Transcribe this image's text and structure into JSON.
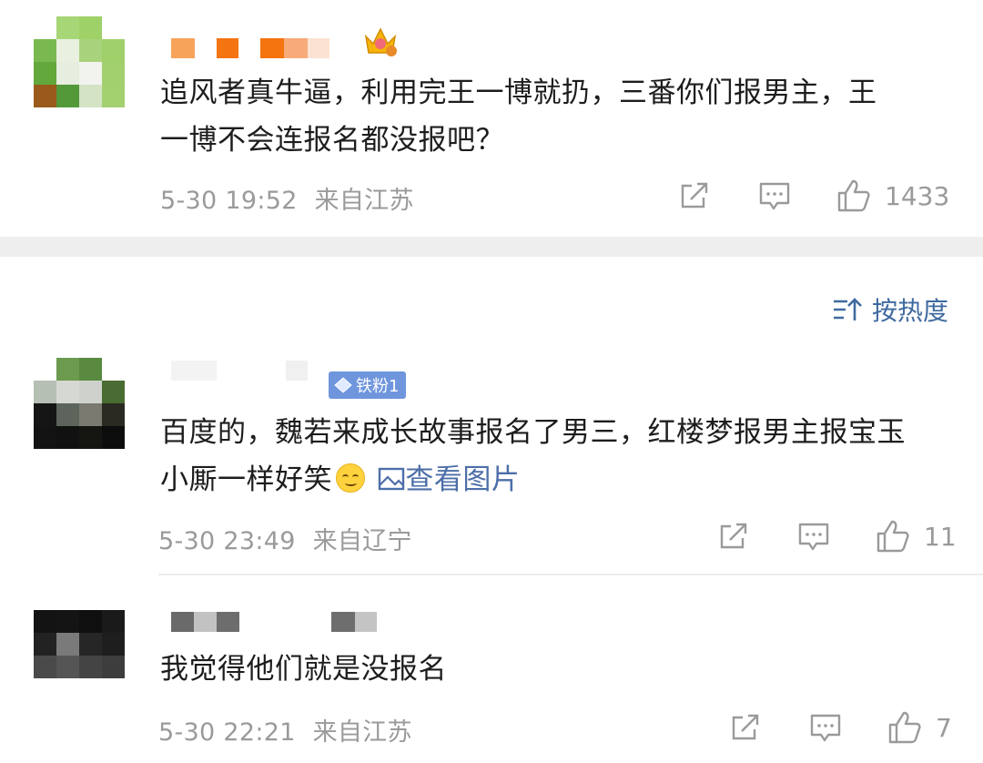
{
  "comments": [
    {
      "text_line1": "追风者真牛逼，利用完王一博就扔，三番你们报男主，王",
      "text_line2": "一博不会连报名都没报吧？",
      "date": "5-30 19:52",
      "location": "来自江苏",
      "likes": "1433",
      "avatar_colors": [
        "#ffffff",
        "#a6d675",
        "#9ed167",
        "#ffffff",
        "#7ab94f",
        "#e9f0df",
        "#a8d27b",
        "#9fd06a",
        "#62a83a",
        "#e7eddf",
        "#f2f3ee",
        "#a2d06f",
        "#9a5a1a",
        "#53993a",
        "#d4e3c4",
        "#a3d170"
      ],
      "name_colors": [
        "#f7a35a",
        "#f57412",
        "#f5740f",
        "#f7ab79",
        "#fbe2d3"
      ]
    },
    {
      "text_line1": "百度的，魏若来成长故事报名了男三，红楼梦报男主报宝玉",
      "text_line2_prefix": "小厮一样好笑",
      "image_link": "查看图片",
      "badge": "铁粉1",
      "date": "5-30 23:49",
      "location": "来自辽宁",
      "likes": "11",
      "avatar_colors": [
        "#ffffff",
        "#6c9a4f",
        "#5a8a40",
        "#ffffff",
        "#b5bfb3",
        "#d6d9d2",
        "#cfd2cc",
        "#496c32",
        "#151515",
        "#5c645c",
        "#7a7a70",
        "#2a2a22",
        "#131313",
        "#111111",
        "#151512",
        "#0d0d0d"
      ],
      "name_colors": [
        "#f3f3f3",
        "#f0f0f0"
      ]
    },
    {
      "text_line1": "我觉得他们就是没报名",
      "date": "5-30 22:21",
      "location": "来自江苏",
      "likes": "7",
      "avatar_colors": [
        "#ffffff",
        "#ffffff",
        "#ffffff",
        "#ffffff",
        "#131313",
        "#141414",
        "#0f0f0f",
        "#1a1a1a",
        "#222222",
        "#7a7a7a",
        "#262626",
        "#1e1e1e",
        "#4a4a4a",
        "#555555",
        "#444444",
        "#3d3d3d"
      ],
      "name_colors": [
        "#6a6a6a",
        "#c2c2c2",
        "#6d6d6d",
        "#6e6e6e",
        "#c4c4c4"
      ]
    }
  ],
  "sort": {
    "label": "按热度"
  },
  "icons": {
    "share": "share-icon",
    "comment": "comment-icon",
    "like": "like-icon",
    "sort": "sort-icon",
    "crown": "crown-icon"
  },
  "colors": {
    "link": "#4d6fa8",
    "meta": "#9a9a9a",
    "badge": "#6f95dd"
  }
}
